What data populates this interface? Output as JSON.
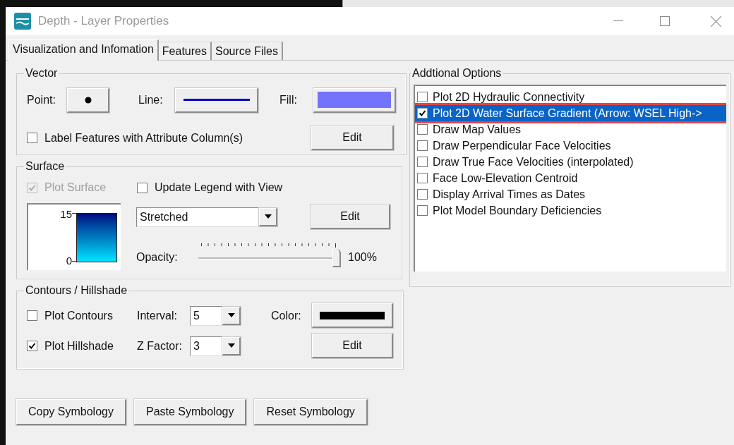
{
  "window": {
    "title": "Depth - Layer Properties"
  },
  "tabs": [
    {
      "label": "Visualization and Infomation",
      "selected": true
    },
    {
      "label": "Features",
      "selected": false
    },
    {
      "label": "Source Files",
      "selected": false
    }
  ],
  "vector": {
    "title": "Vector",
    "point_label": "Point:",
    "line_label": "Line:",
    "fill_label": "Fill:",
    "label_features": {
      "label": "Label Features with Attribute Column(s)",
      "checked": false
    },
    "edit": "Edit"
  },
  "surface": {
    "title": "Surface",
    "plot_surface": {
      "label": "Plot Surface",
      "checked": true,
      "disabled": true
    },
    "update_legend": {
      "label": "Update Legend with View",
      "checked": false
    },
    "legend": {
      "max": "15",
      "min": "0"
    },
    "mode": {
      "value": "Stretched"
    },
    "edit": "Edit",
    "opacity": {
      "label": "Opacity:",
      "level": 1,
      "reading": "100%"
    }
  },
  "contours": {
    "title": "Contours / Hillshade",
    "plot_contours": {
      "label": "Plot Contours",
      "checked": false
    },
    "interval": {
      "label": "Interval:",
      "value": "5"
    },
    "color_label": "Color:",
    "plot_hillshade": {
      "label": "Plot Hillshade",
      "checked": true
    },
    "z_factor": {
      "label": "Z Factor:",
      "value": "3"
    },
    "edit": "Edit"
  },
  "additional_options": {
    "title": "Addtional Options",
    "items": [
      {
        "label": "Plot 2D Hydraulic Connectivity",
        "checked": false,
        "selected": false,
        "highlighted": false
      },
      {
        "label": "Plot 2D Water Surface Gradient (Arrow: WSEL High->",
        "checked": true,
        "selected": true,
        "highlighted": true
      },
      {
        "label": "Draw Map Values",
        "checked": false,
        "selected": false,
        "highlighted": false
      },
      {
        "label": "Draw Perpendicular Face Velocities",
        "checked": false,
        "selected": false,
        "highlighted": false
      },
      {
        "label": "Draw True Face Velocities (interpolated)",
        "checked": false,
        "selected": false,
        "highlighted": false
      },
      {
        "label": "Face Low-Elevation Centroid",
        "checked": false,
        "selected": false,
        "highlighted": false
      },
      {
        "label": "Display Arrival Times as Dates",
        "checked": false,
        "selected": false,
        "highlighted": false
      },
      {
        "label": "Plot Model Boundary Deficiencies",
        "checked": false,
        "selected": false,
        "highlighted": false
      }
    ]
  },
  "buttons": [
    "Copy Symbology",
    "Paste Symbology",
    "Reset Symbology"
  ]
}
